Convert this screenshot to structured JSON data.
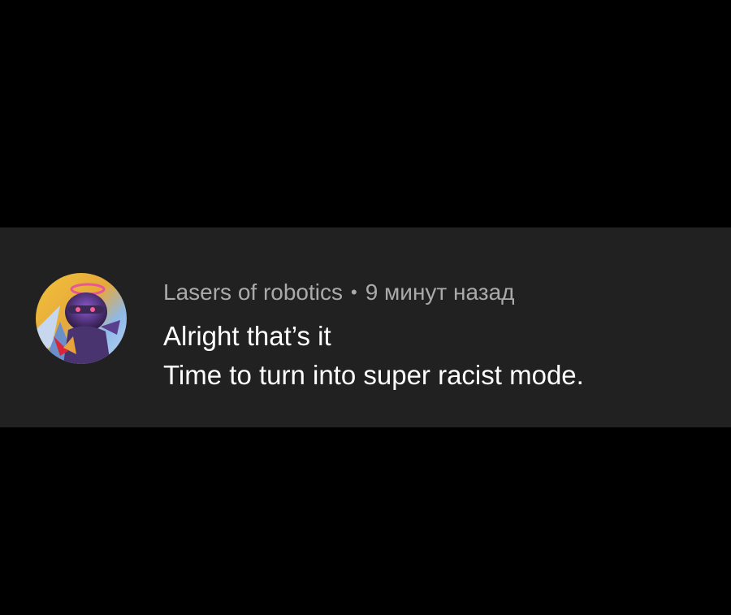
{
  "comment": {
    "author": "Lasers of robotics",
    "separator": "•",
    "timestamp": "9 минут назад",
    "lines": [
      "Alright that’s it",
      "Time to turn into super racist mode."
    ]
  },
  "avatar": {
    "icon": "robot-character-avatar"
  },
  "colors": {
    "page_background": "#000000",
    "card_background": "#212121",
    "meta_text": "#aaaaaa",
    "body_text": "#ffffff"
  }
}
